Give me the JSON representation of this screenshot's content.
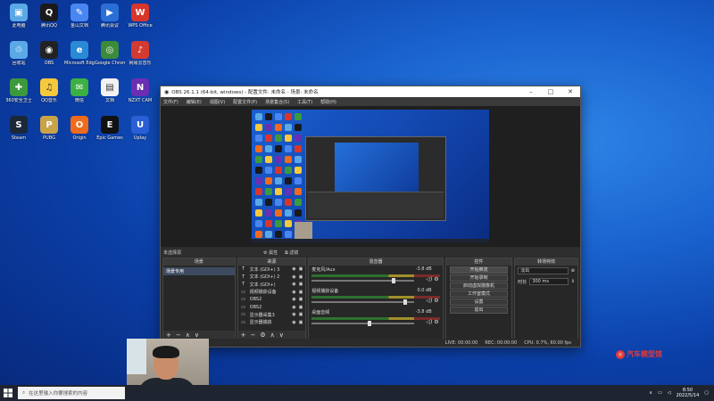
{
  "desktop_icons": [
    {
      "label": "此电脑",
      "color": "#5aa9e6",
      "glyph": "▣"
    },
    {
      "label": "腾讯QQ",
      "color": "#1a1a1a",
      "glyph": "Q"
    },
    {
      "label": "金山文档",
      "color": "#4a86f2",
      "glyph": "✎"
    },
    {
      "label": "腾讯会议",
      "color": "#2b6fd6",
      "glyph": "▶"
    },
    {
      "label": "WPS Office",
      "color": "#d9362b",
      "glyph": "W"
    },
    {
      "label": "回收站",
      "color": "#5aa9e6",
      "glyph": "♲"
    },
    {
      "label": "OBS",
      "color": "#222222",
      "glyph": "◉"
    },
    {
      "label": "Microsoft Edge",
      "color": "#2a8ad6",
      "glyph": "e"
    },
    {
      "label": "Google Chrome",
      "color": "#3b8b3b",
      "glyph": "◎"
    },
    {
      "label": "网易云音乐",
      "color": "#d33a31",
      "glyph": "♪"
    },
    {
      "label": "360安全卫士",
      "color": "#3c9a3c",
      "glyph": "✚"
    },
    {
      "label": "QQ音乐",
      "color": "#f6c83c",
      "glyph": "♫"
    },
    {
      "label": "微信",
      "color": "#3cb043",
      "glyph": "✉"
    },
    {
      "label": "文档",
      "color": "#f2f2f2",
      "glyph": "▤"
    },
    {
      "label": "NZXT CAM",
      "color": "#6a2fb3",
      "glyph": "N"
    },
    {
      "label": "Steam",
      "color": "#1b2838",
      "glyph": "S"
    },
    {
      "label": "PUBG",
      "color": "#c9a34a",
      "glyph": "P"
    },
    {
      "label": "Origin",
      "color": "#f26a1b",
      "glyph": "O"
    },
    {
      "label": "Epic Games",
      "color": "#111111",
      "glyph": "E"
    },
    {
      "label": "Uplay",
      "color": "#2b5fd6",
      "glyph": "U"
    }
  ],
  "obs": {
    "title": "OBS 26.1.1 (64-bit, windows) - 配置文件: 未命名 - 场景: 未命名",
    "menu": [
      "文件(F)",
      "编辑(E)",
      "视图(V)",
      "配置文件(P)",
      "场景集合(S)",
      "工具(T)",
      "帮助(H)"
    ],
    "status_left": "未选择源",
    "status_props": "属性",
    "status_filters": "滤镜",
    "panels": {
      "scenes": "场景",
      "sources": "来源",
      "mixer": "混音器",
      "controls": "控件",
      "transitions": "转场特效"
    },
    "scenes": [
      "场景专用"
    ],
    "sources": [
      {
        "icon": "T",
        "name": "文本 (GDI+) 3"
      },
      {
        "icon": "T",
        "name": "文本 (GDI+) 2"
      },
      {
        "icon": "T",
        "name": "文本 (GDI+)"
      },
      {
        "icon": "▭",
        "name": "视频捕获设备"
      },
      {
        "icon": "▭",
        "name": "OBS2"
      },
      {
        "icon": "▭",
        "name": "OBS2"
      },
      {
        "icon": "▭",
        "name": "显示器采集3"
      },
      {
        "icon": "▭",
        "name": "显示器捕获"
      }
    ],
    "mixer": [
      {
        "name": "麦克风/Aux",
        "db": "-3.8 dB",
        "level": 0.78
      },
      {
        "name": "视频捕获设备",
        "db": "0.0 dB",
        "level": 0.9
      },
      {
        "name": "桌面音频",
        "db": "-3.8 dB",
        "level": 0.55
      }
    ],
    "controls": [
      "开始推流",
      "开始录制",
      "启动虚拟摄像机",
      "工作室模式",
      "设置",
      "退出"
    ],
    "transition_type": "淡出",
    "duration_label": "时长",
    "duration_value": "300 ms",
    "bottom_status": [
      "LIVE: 00:00:00",
      "REC: 00:00:00",
      "CPU: 0.7%, 60.00 fps"
    ]
  },
  "taskbar": {
    "search_placeholder": "在这里输入你要搜索的内容",
    "time": "8:50",
    "date": "2022/5/14"
  },
  "watermark": "汽车模型馆"
}
